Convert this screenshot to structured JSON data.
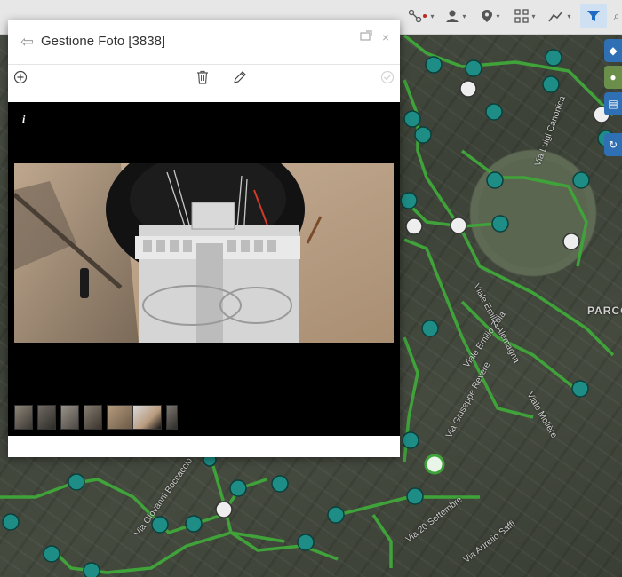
{
  "dialog": {
    "title": "Gestione Foto [3838]",
    "info_label": "i",
    "thumbnail_count": 7
  },
  "toolbar": {
    "icons": [
      "route-icon",
      "user-icon",
      "location-pin-icon",
      "grid-icon",
      "chart-line-icon",
      "filter-icon"
    ]
  },
  "map": {
    "labels": {
      "parco": "PARCO",
      "viale_emilio_alemagna": "Viale Emilio Alemagna",
      "viale_emilio_zola": "Viale Emilio Zola",
      "viale_moliere": "Viale Molière",
      "via_giuseppe_revere": "Via Giuseppe Revere",
      "via_xx_settembre": "Via 20 Settembre",
      "via_aurelio_saffi": "Via Aurelio Saffi",
      "via_luigi_canonica": "Via Luigi Canonica",
      "via_giovanni_boccaccio": "Via Giovanni Boccaccio"
    }
  },
  "colors": {
    "route_green": "#3fa33a",
    "marker_teal": "#1d8d86",
    "dialog_bg": "#ffffff",
    "viewer_bg": "#000000",
    "filter_active": "#1e6bc4"
  }
}
